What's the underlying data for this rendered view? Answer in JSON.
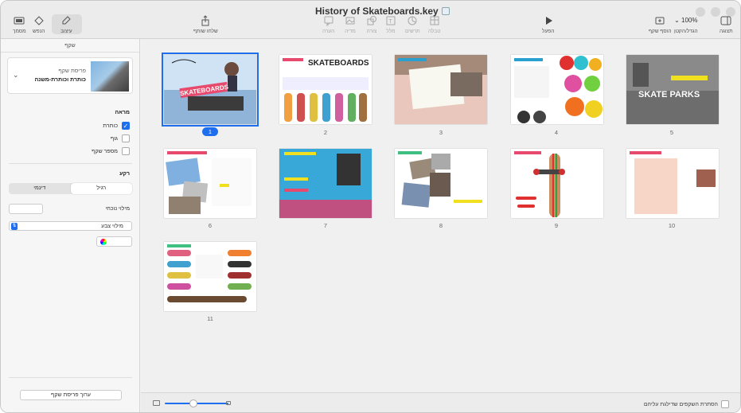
{
  "window": {
    "title": "History of Skateboards.key"
  },
  "toolbar": {
    "view": "תצוגה",
    "zoom_value": "100%",
    "zoom_label": "הגדל/הקטן",
    "add_slide": "הוסף שקף",
    "play": "הפעל",
    "table": "טבלה",
    "chart": "תרשים",
    "text": "מלל",
    "shape": "צורה",
    "media": "מדיה",
    "comment": "הערה",
    "share": "שלחו שותף",
    "format": "עיצוב",
    "animate": "הנפש",
    "document": "מסמך"
  },
  "sidebar": {
    "header": "שקף",
    "layout_label": "פריסת שקף",
    "layout_value": "כותרת וכותרת-משנה",
    "appearance_title": "מראה",
    "checks": [
      {
        "label": "כותרת",
        "checked": true
      },
      {
        "label": "גוף",
        "checked": false
      },
      {
        "label": "מספר שקף",
        "checked": false
      }
    ],
    "background_title": "רקע",
    "seg_regular": "רגיל",
    "seg_dynamic": "דינמי",
    "fill_label": "מילוי נוכחי",
    "fill_select": "מילוי צבע",
    "edit_layout": "ערוך פריסת שקף"
  },
  "slides": [
    {
      "num": "1",
      "selected": true,
      "title": "SKATEBOARDS"
    },
    {
      "num": "2",
      "selected": false,
      "title": "SKATEBOARDS"
    },
    {
      "num": "3",
      "selected": false,
      "title": ""
    },
    {
      "num": "4",
      "selected": false,
      "title": ""
    },
    {
      "num": "5",
      "selected": false,
      "title": "SKATE PARKS"
    },
    {
      "num": "6",
      "selected": false,
      "title": ""
    },
    {
      "num": "7",
      "selected": false,
      "title": ""
    },
    {
      "num": "8",
      "selected": false,
      "title": ""
    },
    {
      "num": "9",
      "selected": false,
      "title": ""
    },
    {
      "num": "10",
      "selected": false,
      "title": ""
    },
    {
      "num": "11",
      "selected": false,
      "title": ""
    }
  ],
  "bottom": {
    "skip_label": "הסתרת השקפים שדילגת עליהם"
  }
}
